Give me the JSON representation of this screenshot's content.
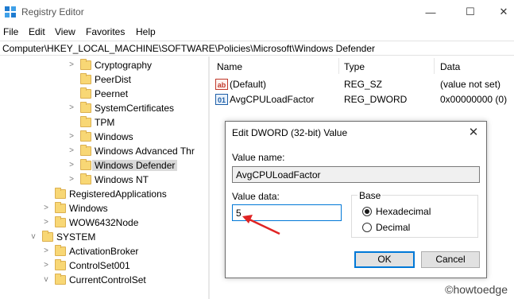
{
  "window": {
    "title": "Registry Editor",
    "controls": {
      "minimize": "—",
      "maximize": "☐",
      "close": "✕"
    }
  },
  "menu": [
    "File",
    "Edit",
    "View",
    "Favorites",
    "Help"
  ],
  "address": "Computer\\HKEY_LOCAL_MACHINE\\SOFTWARE\\Policies\\Microsoft\\Windows Defender",
  "tree": [
    {
      "label": "Cryptography",
      "expander": ">"
    },
    {
      "label": "PeerDist",
      "expander": ""
    },
    {
      "label": "Peernet",
      "expander": ""
    },
    {
      "label": "SystemCertificates",
      "expander": ">"
    },
    {
      "label": "TPM",
      "expander": ""
    },
    {
      "label": "Windows",
      "expander": ">"
    },
    {
      "label": "Windows Advanced Thr",
      "expander": ">"
    },
    {
      "label": "Windows Defender",
      "expander": ">",
      "selected": true
    },
    {
      "label": "Windows NT",
      "expander": ">"
    },
    {
      "label": "RegisteredApplications",
      "expander": ""
    },
    {
      "label": "Windows",
      "expander": ">"
    },
    {
      "label": "WOW6432Node",
      "expander": ">"
    },
    {
      "label": "SYSTEM",
      "expander": "v"
    },
    {
      "label": "ActivationBroker",
      "expander": ">"
    },
    {
      "label": "ControlSet001",
      "expander": ">"
    },
    {
      "label": "CurrentControlSet",
      "expander": "v"
    }
  ],
  "columns": {
    "name": "Name",
    "type": "Type",
    "data": "Data"
  },
  "values": [
    {
      "icon": "ab",
      "name": "(Default)",
      "type": "REG_SZ",
      "data": "(value not set)"
    },
    {
      "icon": "01",
      "name": "AvgCPULoadFactor",
      "type": "REG_DWORD",
      "data": "0x00000000 (0)"
    }
  ],
  "dialog": {
    "title": "Edit DWORD (32-bit) Value",
    "value_name_label": "Value name:",
    "value_name": "AvgCPULoadFactor",
    "value_data_label": "Value data:",
    "value_data": "5",
    "base_label": "Base",
    "hex_label": "Hexadecimal",
    "dec_label": "Decimal",
    "base_selected": "Hexadecimal",
    "ok_label": "OK",
    "cancel_label": "Cancel",
    "close_glyph": "✕"
  },
  "watermark": "©howtoedge",
  "colors": {
    "folder": "#f8d775",
    "accent": "#0078d7",
    "arrow": "#e02424",
    "selected_row": "#d9d9d9"
  }
}
